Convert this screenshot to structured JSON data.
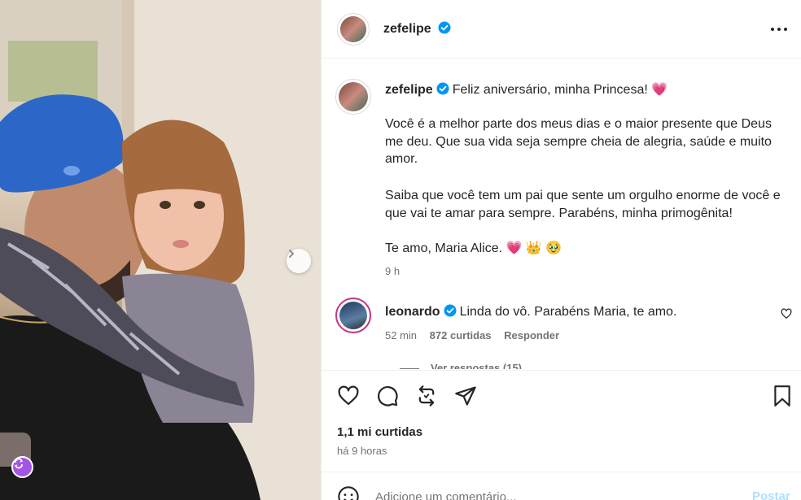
{
  "post": {
    "author": "zefelipe",
    "more_icon": "more-horizontal-icon",
    "caption": {
      "author": "zefelipe",
      "headline": "Feliz aniversário, minha Princesa! 💗",
      "paragraph1": "Você é a melhor parte dos meus dias e o maior presente que Deus me deu. Que sua vida seja sempre cheia de alegria, saúde e muito amor.",
      "paragraph2": "Saiba que você tem um pai que sente um orgulho enorme de você e que vai te amar para sempre. Parabéns, minha primogênita!",
      "paragraph3": "Te amo, Maria Alice. 💗 👑 🥹",
      "time": "9 h"
    },
    "comments": [
      {
        "author": "leonardo",
        "text": "Linda do vô. Parabéns Maria, te amo.",
        "time": "52 min",
        "likes": "872 curtidas",
        "reply_label": "Responder",
        "view_replies": "Ver respostas (15)"
      }
    ],
    "likes": "1,1 mi curtidas",
    "posted": "há 9 horas",
    "comment_placeholder": "Adicione um comentário...",
    "post_label": "Postar"
  },
  "colors": {
    "verified": "#0095f6",
    "heart": "#ff3b6b",
    "post_button": "#b2dffc",
    "badge": "#a454e6"
  }
}
